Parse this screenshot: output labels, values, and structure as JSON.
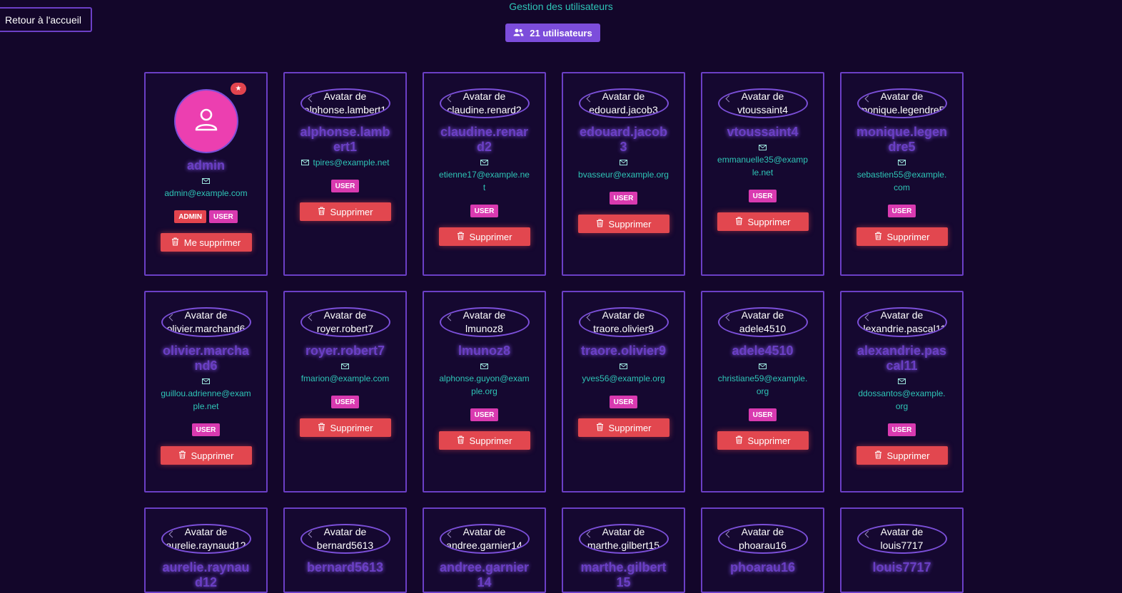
{
  "nav": {
    "back_label": "Retour à l'accueil"
  },
  "header": {
    "title": "Gestion des utilisateurs",
    "count_label": "21 utilisateurs"
  },
  "avatar_prefix": "Avatar de",
  "colors": {
    "background": "#13062a",
    "accent": "#7c4ddb",
    "teal": "#2ec4b6",
    "danger": "#e2474f",
    "pink": "#ec3fb0"
  },
  "users": [
    {
      "username": "admin",
      "email": "admin@example.com",
      "roles": [
        "ADMIN",
        "USER"
      ],
      "action": "Me supprimer",
      "is_self": true
    },
    {
      "username": "alphonse.lambert1",
      "email": "tpires@example.net",
      "roles": [
        "USER"
      ],
      "action": "Supprimer"
    },
    {
      "username": "claudine.renard2",
      "email": "etienne17@example.net",
      "roles": [
        "USER"
      ],
      "action": "Supprimer"
    },
    {
      "username": "edouard.jacob3",
      "email": "bvasseur@example.org",
      "roles": [
        "USER"
      ],
      "action": "Supprimer"
    },
    {
      "username": "vtoussaint4",
      "email": "emmanuelle35@example.net",
      "roles": [
        "USER"
      ],
      "action": "Supprimer"
    },
    {
      "username": "monique.legendre5",
      "email": "sebastien55@example.com",
      "roles": [
        "USER"
      ],
      "action": "Supprimer"
    },
    {
      "username": "olivier.marchand6",
      "email": "guillou.adrienne@example.net",
      "roles": [
        "USER"
      ],
      "action": "Supprimer"
    },
    {
      "username": "royer.robert7",
      "email": "fmarion@example.com",
      "roles": [
        "USER"
      ],
      "action": "Supprimer"
    },
    {
      "username": "lmunoz8",
      "email": "alphonse.guyon@example.org",
      "roles": [
        "USER"
      ],
      "action": "Supprimer"
    },
    {
      "username": "traore.olivier9",
      "email": "yves56@example.org",
      "roles": [
        "USER"
      ],
      "action": "Supprimer"
    },
    {
      "username": "adele4510",
      "email": "christiane59@example.org",
      "roles": [
        "USER"
      ],
      "action": "Supprimer"
    },
    {
      "username": "alexandrie.pascal11",
      "email": "ddossantos@example.org",
      "roles": [
        "USER"
      ],
      "action": "Supprimer"
    },
    {
      "username": "aurelie.raynaud12",
      "email": "",
      "roles": [],
      "action": ""
    },
    {
      "username": "bernard5613",
      "email": "",
      "roles": [],
      "action": ""
    },
    {
      "username": "andree.garnier14",
      "email": "",
      "roles": [],
      "action": ""
    },
    {
      "username": "marthe.gilbert15",
      "email": "",
      "roles": [],
      "action": ""
    },
    {
      "username": "phoarau16",
      "email": "",
      "roles": [],
      "action": ""
    },
    {
      "username": "louis7717",
      "email": "",
      "roles": [],
      "action": ""
    }
  ]
}
